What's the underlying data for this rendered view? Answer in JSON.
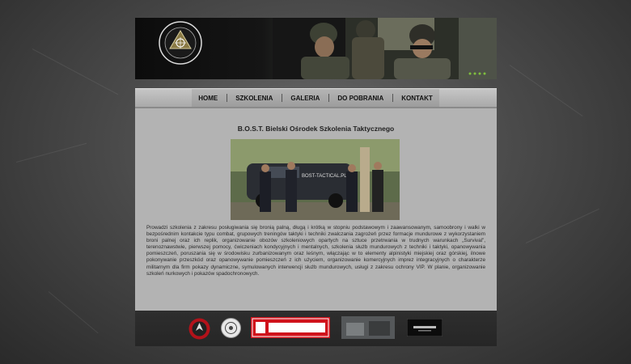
{
  "nav": {
    "items": [
      {
        "label": "HOME"
      },
      {
        "label": "SZKOLENIA"
      },
      {
        "label": "GALERIA"
      },
      {
        "label": "DO POBRANIA"
      },
      {
        "label": "KONTAKT"
      }
    ]
  },
  "main": {
    "title": "B.O.S.T. Bielski Ośrodek Szkolenia Taktycznego",
    "photo_sign": "BOST-TACTICAL.PL",
    "description": "Prowadzi szkolenia z zakresu posługiwania się bronią palną, długą i krótką w stopniu podstawowym i zaawansowanym, samoobrony i walki w bezpośrednim kontakcie typu combat, grupowych treningów taktyki i techniki zwalczania zagrożeń przez formacje mundurowe z wykorzystaniem broni palnej oraz ich replik, organizowanie obozów szkoleniowych opartych na sztuce przetrwania w trudnych warunkach „Survival”, terenoznawstwie, pierwszej pomocy, ćwiczeniach kondycyjnych i mentalnych, szkolenia służb mundurowych z techniki i taktyki, opanowywania pomieszczeń, poruszania się w środowisku zurbanizowanym oraz leśnym, włączając w to elementy alpinistyki miejskiej oraz górskiej, ilnowe pokonywanie przeszkód oraz opanowywanie pomieszczeń z ich użyciem, organizowanie komercyjnych imprez integracyjnych o charakterze militarnym dla firm pokazy dynamiczne, symulowanych interwencji służb mundurowych, usługi z zakresu ochrony VIP. W planie, organizowanie szkoleń nurkowych i pokazów spadochronowych."
  },
  "footer": {
    "sponsors": [
      {
        "name": "eagle-emblem"
      },
      {
        "name": "round-emblem"
      },
      {
        "name": "MacTronic"
      },
      {
        "name": "training-room"
      },
      {
        "name": "beast-logo"
      }
    ]
  },
  "colors": {
    "content_bg": "#b3b3b3",
    "footer_bg": "#2b2b2b",
    "mactronic_red": "#d0121b"
  }
}
